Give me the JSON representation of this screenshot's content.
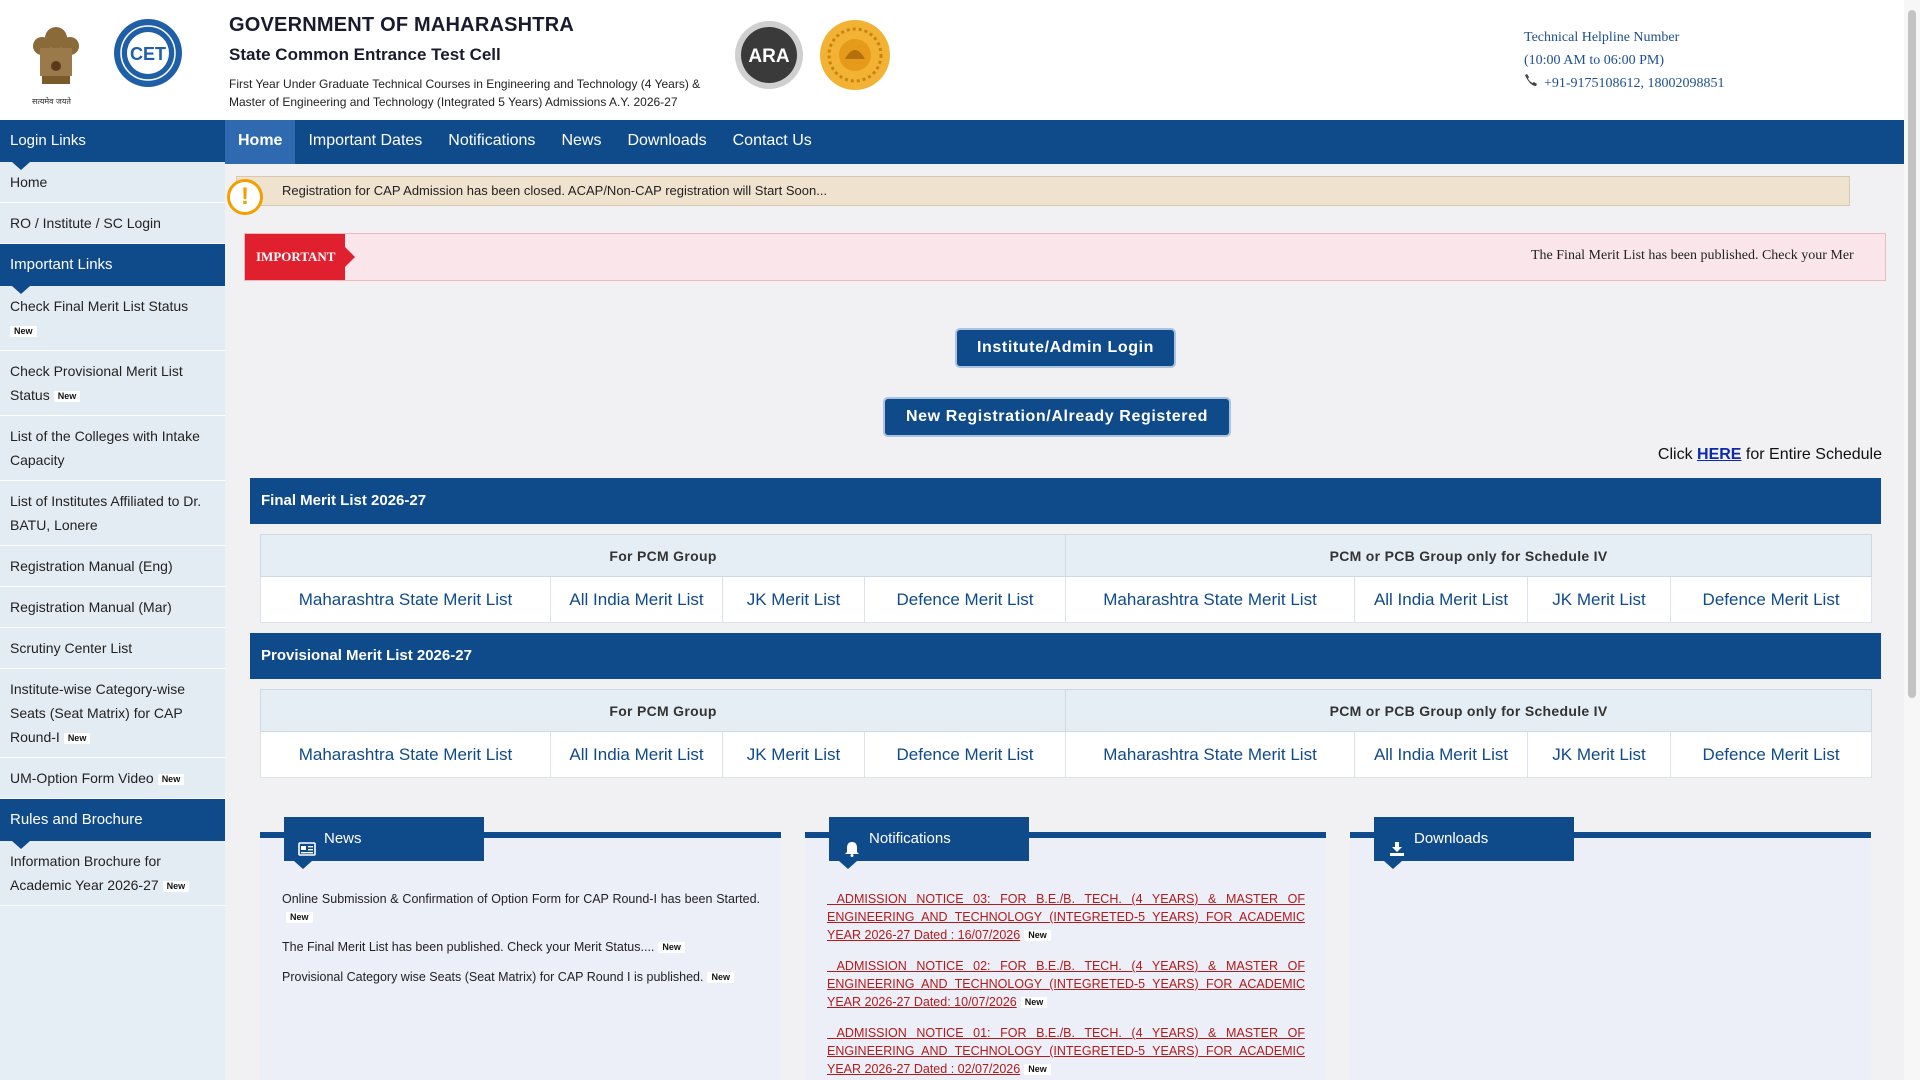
{
  "header": {
    "gov_title": "GOVERNMENT OF MAHARASHTRA",
    "cell_title": "State Common Entrance Test Cell",
    "course_line1": "First Year Under Graduate Technical Courses in Engineering and Technology (4 Years) &",
    "course_line2": "Master of Engineering and Technology (Integrated 5 Years) Admissions A.Y. 2026-27",
    "emblem_caption": "सत्यमेव जयते",
    "cet_logo_text": "CET",
    "ara_logo_text": "ARA",
    "helpline_title": "Technical Helpline Number",
    "helpline_hours": "(10:00 AM to 06:00 PM)",
    "helpline_numbers": "+91-9175108612, 18002098851"
  },
  "nav": {
    "items": [
      "Home",
      "Important Dates",
      "Notifications",
      "News",
      "Downloads",
      "Contact Us"
    ],
    "active": "Home"
  },
  "sidebar": {
    "login_links_title": "Login Links",
    "login_links": [
      "Home",
      "RO / Institute / SC Login"
    ],
    "important_links_title": "Important Links",
    "important_links": [
      {
        "label": "Check Final Merit List Status",
        "new": true
      },
      {
        "label": "Check Provisional Merit List Status",
        "new": true
      },
      {
        "label": "List of the Colleges with Intake Capacity",
        "new": false
      },
      {
        "label": "List of Institutes Affiliated to Dr. BATU, Lonere",
        "new": false
      },
      {
        "label": "Registration Manual (Eng)",
        "new": false
      },
      {
        "label": "Registration Manual (Mar)",
        "new": false
      },
      {
        "label": "Scrutiny Center List",
        "new": false
      },
      {
        "label": "Institute-wise Category-wise Seats (Seat Matrix) for CAP Round-I",
        "new": true
      },
      {
        "label": "UM-Option Form Video",
        "new": true
      }
    ],
    "rules_title": "Rules and Brochure",
    "rules_links": [
      {
        "label": "Information Brochure for Academic Year 2026-27",
        "new": true
      }
    ],
    "new_badge": "New"
  },
  "main": {
    "alert_text": "Registration for CAP Admission has been closed. ACAP/Non-CAP registration will Start Soon...",
    "ticker_label": "IMPORTANT",
    "ticker_text": "The Final Merit List has been published. Check your Mer",
    "login_button": "Institute/Admin Login",
    "register_button": "New Registration/Already Registered",
    "schedule_prefix": "Click ",
    "schedule_link": "HERE",
    "schedule_suffix": " for Entire Schedule",
    "final_title": "Final Merit List 2026-27",
    "provisional_title": "Provisional Merit List 2026-27",
    "group_pcm": "For PCM Group",
    "group_pcb": "PCM or PCB Group only for Schedule IV",
    "merit_links": [
      "Maharashtra State Merit List",
      "All India Merit List",
      "JK Merit List",
      "Defence Merit List"
    ]
  },
  "panels": {
    "news_title": "News",
    "notifications_title": "Notifications",
    "downloads_title": "Downloads",
    "news_items": [
      "Online Submission & Confirmation of Option Form for CAP Round-I has been Started.",
      "The Final Merit List has been published. Check your Merit Status....",
      "Provisional Category wise Seats (Seat Matrix) for CAP Round I is published."
    ],
    "notification_items": [
      "ADMISSION NOTICE 03: FOR B.E./B. TECH. (4 YEARS) & MASTER OF ENGINEERING AND TECHNOLOGY (INTEGRETED-5 YEARS) FOR ACADEMIC YEAR 2026-27 Dated : 16/07/2026",
      "ADMISSION NOTICE 02: FOR B.E./B. TECH. (4 YEARS) & MASTER OF ENGINEERING AND TECHNOLOGY (INTEGRETED-5 YEARS) FOR ACADEMIC YEAR 2026-27 Dated: 10/07/2026",
      "ADMISSION NOTICE 01: FOR B.E./B. TECH. (4 YEARS) & MASTER OF ENGINEERING AND TECHNOLOGY (INTEGRETED-5 YEARS) FOR ACADEMIC YEAR 2026-27 Dated : 02/07/2026"
    ]
  },
  "colors": {
    "primary_blue": "#0f4a8a",
    "important_red": "#e0202f",
    "notice_red": "#b01c1c",
    "alert_orange": "#f0a000"
  }
}
